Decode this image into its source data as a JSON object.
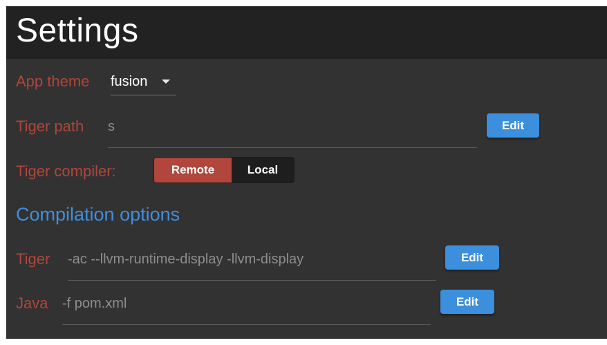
{
  "header": {
    "title": "Settings"
  },
  "app_theme": {
    "label": "App theme",
    "selected": "fusion"
  },
  "tiger_path": {
    "label": "Tiger path",
    "value": "s",
    "edit_label": "Edit"
  },
  "tiger_compiler": {
    "label": "Tiger compiler:",
    "options": [
      "Remote",
      "Local"
    ],
    "selected": "Remote"
  },
  "compilation": {
    "heading": "Compilation options",
    "tiger": {
      "label": "Tiger",
      "value": "-ac --llvm-runtime-display -llvm-display",
      "edit_label": "Edit"
    },
    "java": {
      "label": "Java",
      "value": "-f pom.xml",
      "edit_label": "Edit"
    }
  },
  "colors": {
    "header_bg": "#222222",
    "panel_bg": "#323232",
    "label": "#b0463c",
    "accent_blue": "#3c8fdd",
    "section_heading": "#3f8fdc",
    "segment_active": "#b0463c"
  }
}
